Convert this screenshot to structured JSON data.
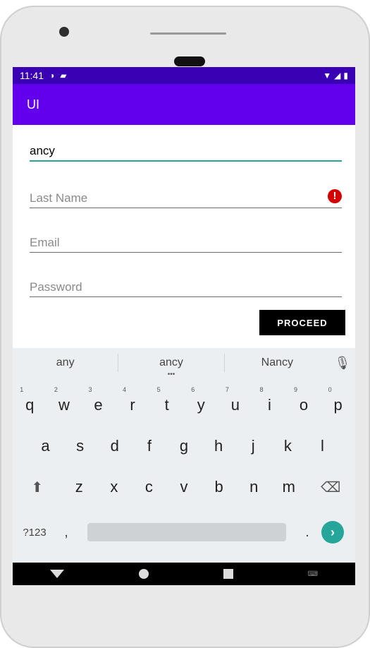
{
  "status_bar": {
    "time": "11:41"
  },
  "app_bar": {
    "title": "UI"
  },
  "form": {
    "first_name_value": "ancy",
    "last_name_placeholder": "Last Name",
    "email_placeholder": "Email",
    "password_placeholder": "Password",
    "proceed_label": "PROCEED"
  },
  "keyboard": {
    "suggestions": [
      "any",
      "ancy",
      "Nancy"
    ],
    "row1": [
      {
        "k": "q",
        "h": "1"
      },
      {
        "k": "w",
        "h": "2"
      },
      {
        "k": "e",
        "h": "3"
      },
      {
        "k": "r",
        "h": "4"
      },
      {
        "k": "t",
        "h": "5"
      },
      {
        "k": "y",
        "h": "6"
      },
      {
        "k": "u",
        "h": "7"
      },
      {
        "k": "i",
        "h": "8"
      },
      {
        "k": "o",
        "h": "9"
      },
      {
        "k": "p",
        "h": "0"
      }
    ],
    "row2": [
      "a",
      "s",
      "d",
      "f",
      "g",
      "h",
      "j",
      "k",
      "l"
    ],
    "row3": [
      "z",
      "x",
      "c",
      "v",
      "b",
      "n",
      "m"
    ],
    "num_switch": "?123",
    "comma": ",",
    "period": "."
  },
  "colors": {
    "status_bar": "#3a00b3",
    "app_bar": "#6200ee",
    "accent": "#26a69a",
    "error": "#d50000",
    "proceed_bg": "#000000"
  },
  "icons": [
    "wifi-icon",
    "signal-icon",
    "battery-icon",
    "error-icon",
    "mic-icon",
    "shift-icon",
    "backspace-icon",
    "go-icon",
    "nav-back-icon",
    "nav-home-icon",
    "nav-recents-icon"
  ]
}
